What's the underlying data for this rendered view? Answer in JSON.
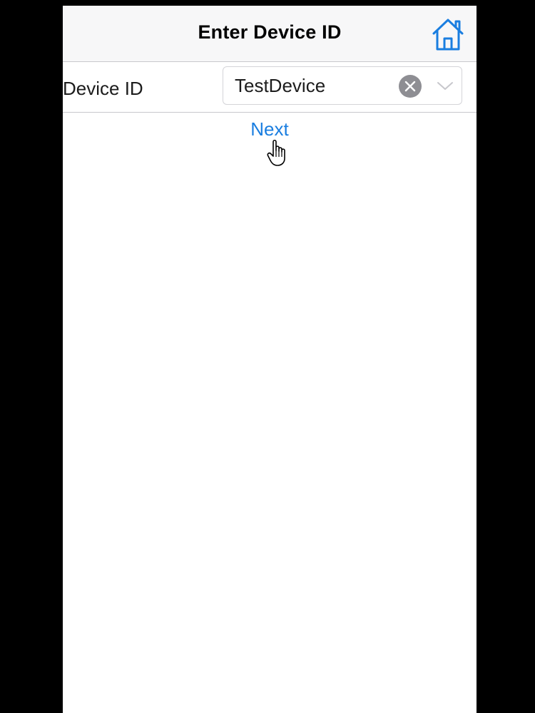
{
  "header": {
    "title": "Enter Device ID",
    "home_icon": "home-icon"
  },
  "form": {
    "device_id_label": "Device ID",
    "device_id_value": "TestDevice",
    "clear_icon": "clear-icon",
    "dropdown_icon": "chevron-down-icon"
  },
  "actions": {
    "next_label": "Next"
  },
  "colors": {
    "accent": "#1a7ee0",
    "nav_background": "#f7f7f8",
    "separator": "#c8c8cc",
    "clear_button": "#8e8e93"
  }
}
